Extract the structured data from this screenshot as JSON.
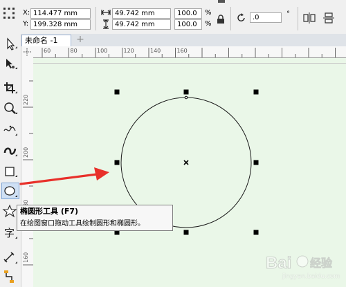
{
  "propbar": {
    "x_label": "X:",
    "x_value": "114.477 mm",
    "y_label": "Y:",
    "y_value": "199.328 mm",
    "width_value": "49.742 mm",
    "height_value": "49.742 mm",
    "scale_w": "100.0",
    "scale_h": "100.0",
    "percent_w": "%",
    "percent_h": "%",
    "rotation_value": ".0",
    "degree": "°"
  },
  "tabs": [
    {
      "label": "未命名 -1"
    }
  ],
  "ruler": {
    "top_ticks": [
      "60",
      "80",
      "100",
      "120",
      "140",
      "160"
    ],
    "left_ticks": [
      "220",
      "200",
      "180",
      "160"
    ]
  },
  "tooltip": {
    "title": "椭圆形工具 (F7)",
    "description": "在绘图窗口拖动工具绘制圆形和椭圆形。"
  },
  "watermark": {
    "brand": "Bai",
    "brand_suffix": "经验",
    "url": "jingyan.baidu.com"
  },
  "colors": {
    "arrow": "#e8302a",
    "canvas": "#eaf7e8",
    "tab_bar": "#dfe3e8"
  },
  "icons": [
    "pick-tool-icon",
    "shape-tool-icon",
    "crop-tool-icon",
    "zoom-tool-icon",
    "freehand-tool-icon",
    "artistic-media-icon",
    "rectangle-tool-icon",
    "ellipse-tool-icon",
    "polygon-tool-icon",
    "text-tool-icon",
    "dimension-tool-icon",
    "connector-tool-icon"
  ]
}
